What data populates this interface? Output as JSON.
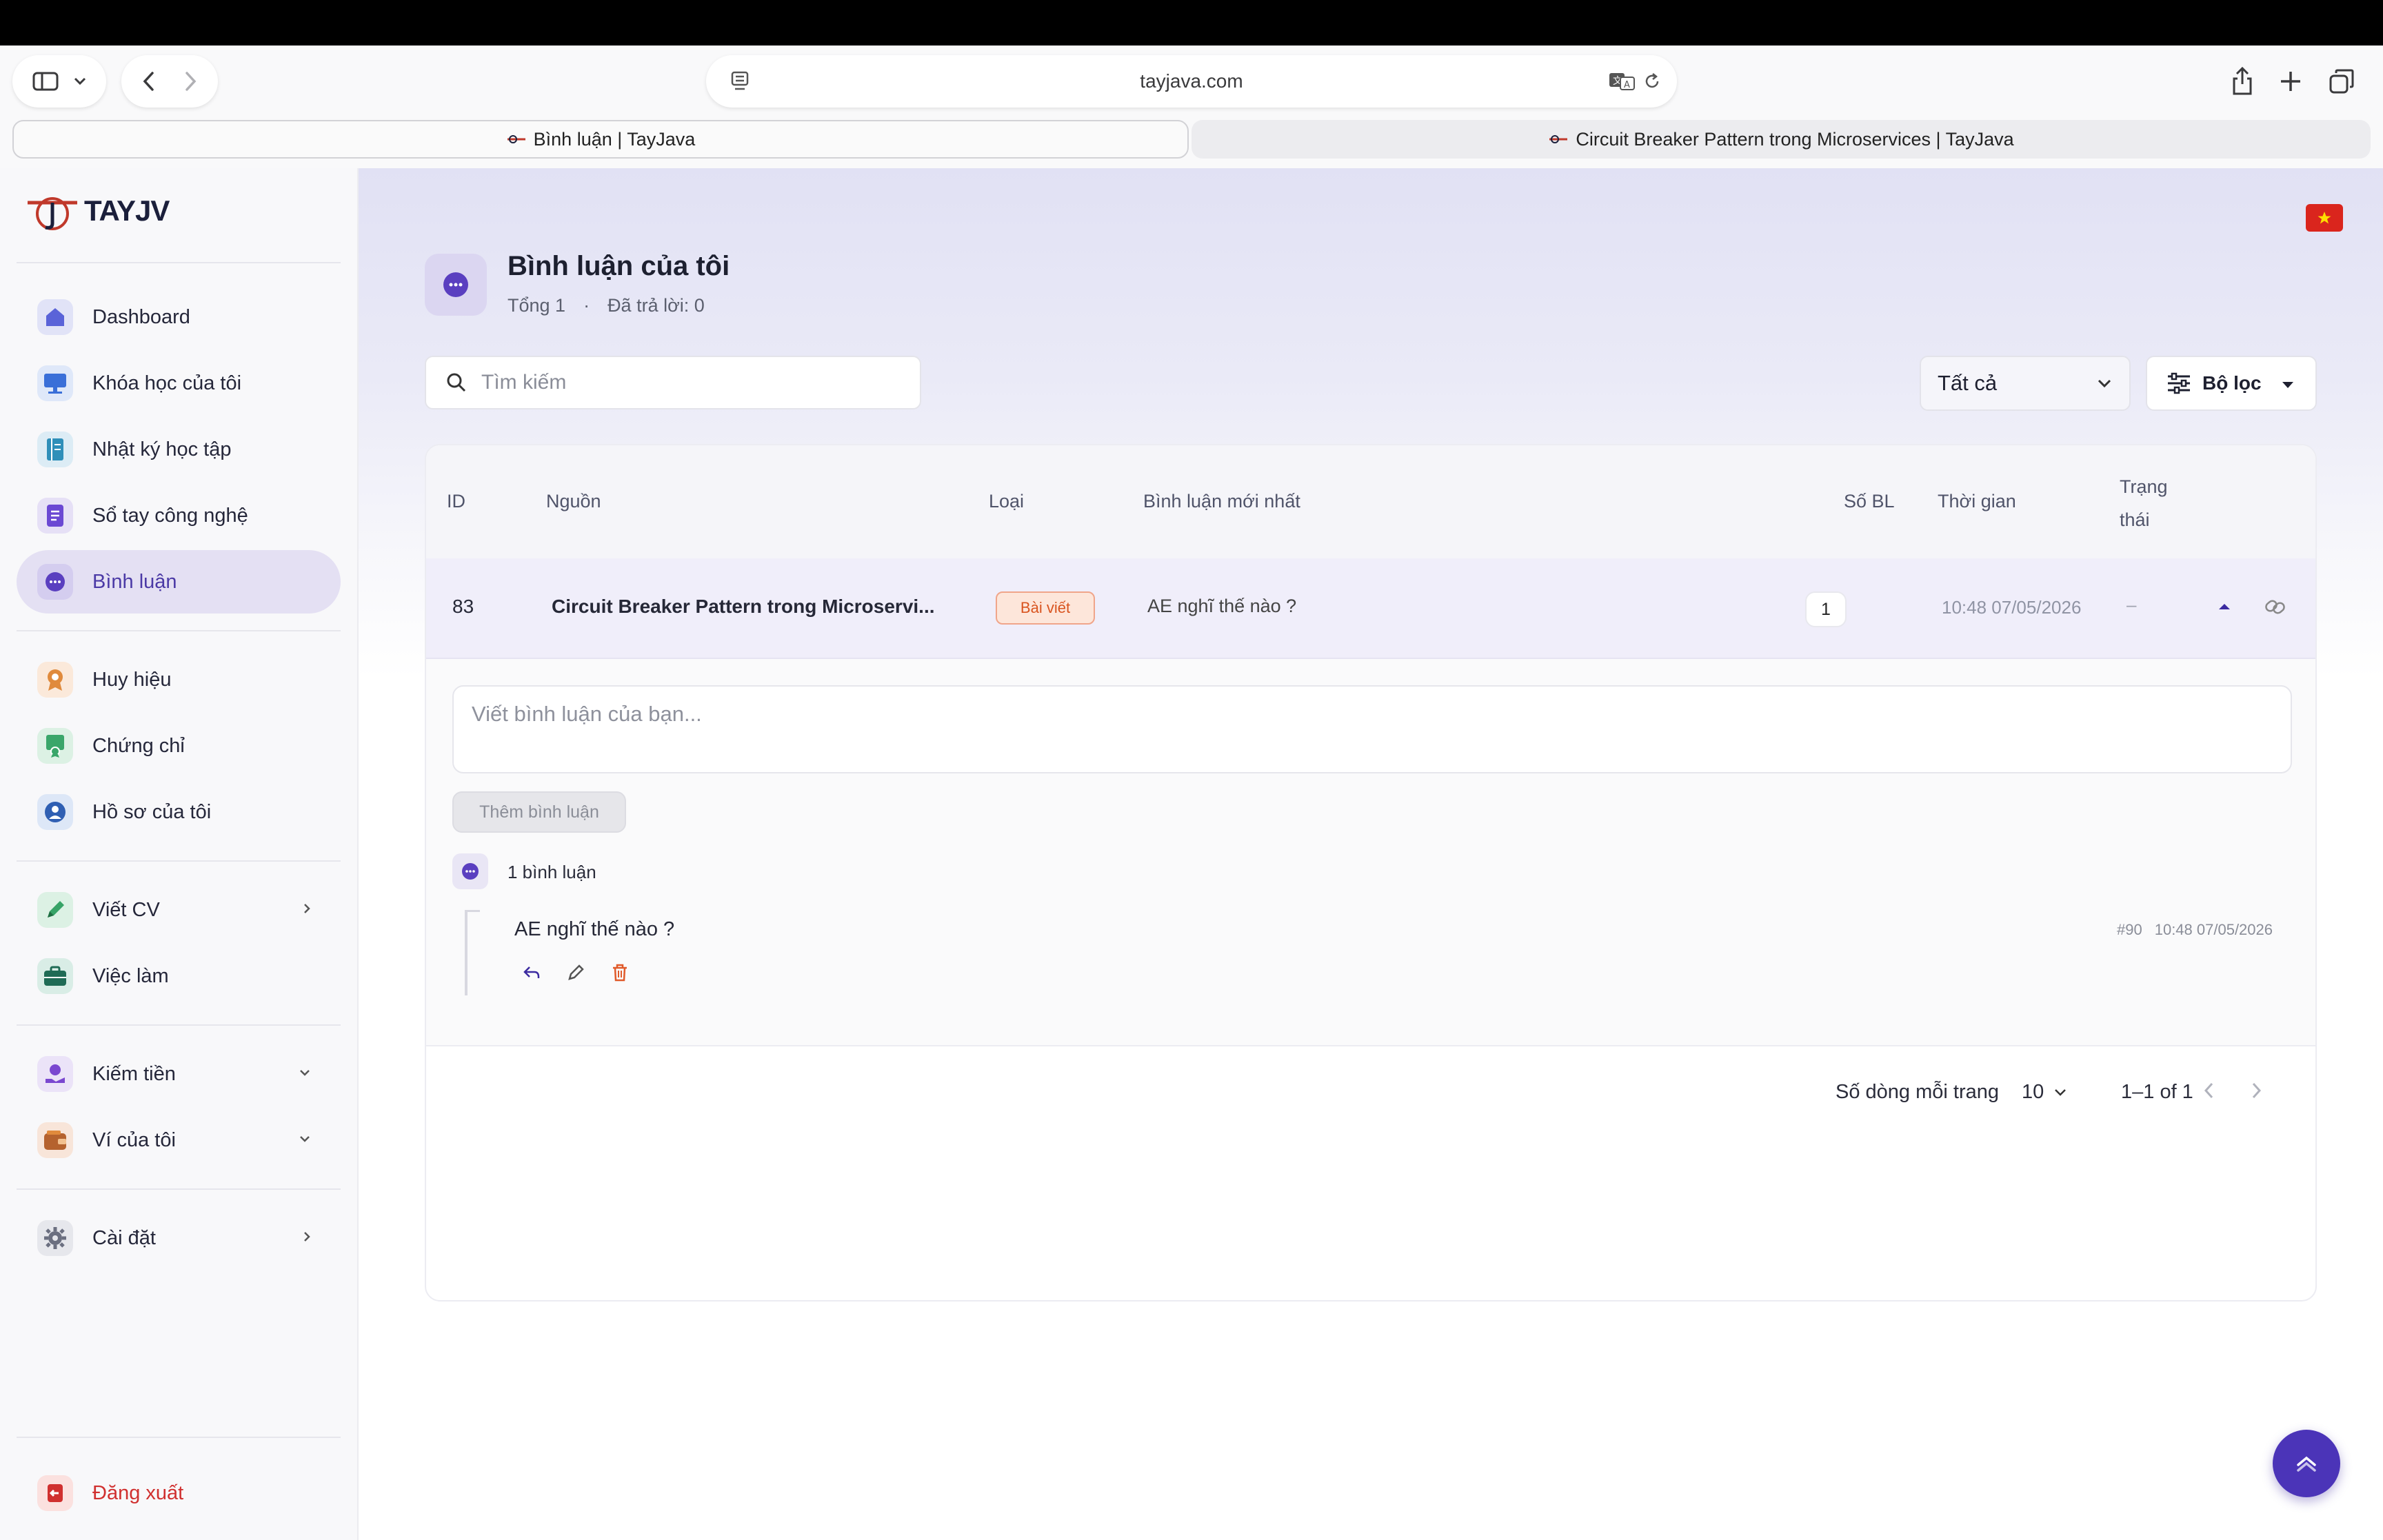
{
  "browser": {
    "url": "tayjava.com",
    "tabs": [
      {
        "label": "Bình luận | TayJava"
      },
      {
        "label": "Circuit Breaker Pattern trong Microservices | TayJava"
      }
    ]
  },
  "sidebar": {
    "logo_text": "TAYJV",
    "items": [
      {
        "label": "Dashboard",
        "icon": "home-icon"
      },
      {
        "label": "Khóa học của tôi",
        "icon": "monitor-icon"
      },
      {
        "label": "Nhật ký học tập",
        "icon": "notebook-icon"
      },
      {
        "label": "Sổ tay công nghệ",
        "icon": "document-icon"
      },
      {
        "label": "Bình luận",
        "icon": "comment-icon"
      },
      {
        "label": "Huy hiệu",
        "icon": "badge-icon"
      },
      {
        "label": "Chứng chỉ",
        "icon": "certificate-icon"
      },
      {
        "label": "Hồ sơ của tôi",
        "icon": "user-icon"
      },
      {
        "label": "Viết CV",
        "icon": "pen-icon"
      },
      {
        "label": "Việc làm",
        "icon": "briefcase-icon"
      },
      {
        "label": "Kiếm tiền",
        "icon": "money-hand-icon"
      },
      {
        "label": "Ví của tôi",
        "icon": "wallet-icon"
      },
      {
        "label": "Cài đặt",
        "icon": "gear-icon"
      }
    ],
    "logout_label": "Đăng xuất"
  },
  "header": {
    "title": "Bình luận của tôi",
    "total": "Tổng 1",
    "dot": "·",
    "replied": "Đã trả lời: 0"
  },
  "toolbar": {
    "search_placeholder": "Tìm kiếm",
    "select_value": "Tất cả",
    "filter_label": "Bộ lọc"
  },
  "table": {
    "headers": {
      "id": "ID",
      "source": "Nguồn",
      "type": "Loại",
      "latest": "Bình luận mới nhất",
      "count": "Số BL",
      "time": "Thời gian",
      "status_line1": "Trạng",
      "status_line2": "thái"
    },
    "row": {
      "id": "83",
      "source": "Circuit Breaker Pattern trong Microservi...",
      "type": "Bài viết",
      "latest": "AE nghĩ thế nào ?",
      "count": "1",
      "time": "10:48 07/05/2026",
      "status": "–"
    }
  },
  "detail": {
    "input_placeholder": "Viết bình luận của bạn...",
    "add_button": "Thêm bình luận",
    "comment_count": "1 bình luận",
    "comment": {
      "text": "AE nghĩ thế nào ?",
      "id": "#90",
      "time": "10:48 07/05/2026"
    }
  },
  "pagination": {
    "rows_label": "Số dòng mỗi trang",
    "rows_value": "10",
    "range": "1–1 of 1"
  },
  "colors": {
    "accent": "#4b34b8",
    "active_nav_bg": "#e4e0f3",
    "badge_text": "#d9541f",
    "logout": "#d0302f"
  }
}
